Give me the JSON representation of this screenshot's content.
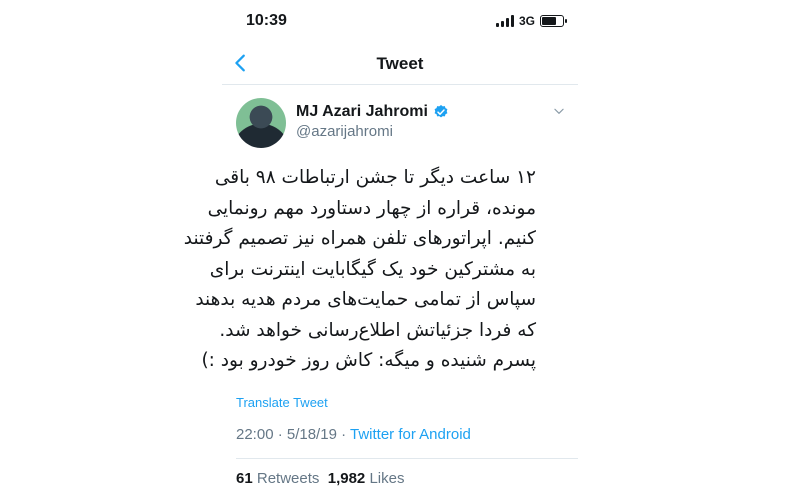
{
  "status_bar": {
    "time": "10:39",
    "network": "3G",
    "icons": [
      "signal-bars-icon",
      "battery-icon"
    ]
  },
  "nav": {
    "back_icon": "chevron-left-icon",
    "title": "Tweet"
  },
  "author": {
    "name": "MJ Azari Jahromi",
    "handle": "@azarijahromi",
    "verified_icon": "verified-badge-icon",
    "menu_icon": "chevron-down-icon"
  },
  "tweet": {
    "lines": [
      "۱۲ ساعت دیگر تا جشن ارتباطات ۹۸ باقی",
      "مونده، قراره از چهار دستاورد مهم رونمایی",
      "کنیم. اپراتورهای تلفن همراه نیز تصمیم گرفتند",
      "به مشترکین خود یک گیگابایت اینترنت برای",
      "سپاس از تمامی حمایت‌های مردم هدیه بدهند",
      "که فردا جزئیاتش اطلاع‌رسانی خواهد شد.",
      "پسرم شنیده و میگه: کاش روز خودرو بود :)"
    ],
    "translate_label": "Translate Tweet",
    "timestamp": "22:00 · 5/18/19 · ",
    "client": "Twitter for Android"
  },
  "stats": {
    "retweets_count": "61",
    "retweets_label": "Retweets",
    "likes_count": "1,982",
    "likes_label": "Likes"
  },
  "colors": {
    "accent": "#1da1f2",
    "secondary_text": "#657786",
    "divider": "#e1e8ed"
  }
}
